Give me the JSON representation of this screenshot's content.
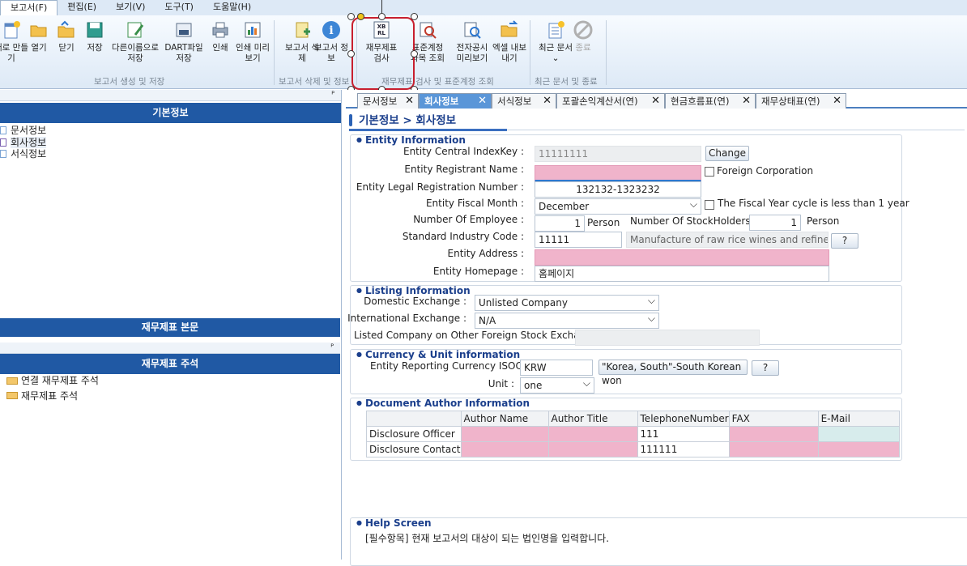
{
  "menu": [
    "보고서(F)",
    "편집(E)",
    "보기(V)",
    "도구(T)",
    "도움말(H)"
  ],
  "ribbon": {
    "buttons": [
      "새로 만들기",
      "열기",
      "닫기",
      "저장",
      "다른이름으로 저장",
      "DART파일 저장",
      "인쇄",
      "인쇄 미리보기",
      "보고서 삭제",
      "보고서 정보",
      "재무제표 검사",
      "표준계정과목 조회",
      "전자공시 미리보기",
      "엑셀 내보내기",
      "최근 문서",
      "종료"
    ],
    "groups": [
      "보고서 생성 및 저장",
      "보고서 삭제 및 정보",
      "재무제표 검사 및 표준계정 조회",
      "최근 문서 및 종료"
    ]
  },
  "left": {
    "pin": "ᴾ",
    "basic_header": "기본정보",
    "basic_items": [
      "문서정보",
      "회사정보",
      "서식정보"
    ],
    "body_header": "재무제표 본문",
    "notes_header": "재무제표 주석",
    "notes_items": [
      "연결 재무제표 주석",
      "재무제표 주석"
    ]
  },
  "tabs": [
    "문서정보",
    "회사정보",
    "서식정보",
    "포괄손익계산서(연)",
    "현금흐름표(연)",
    "재무상태표(연)"
  ],
  "close_glyph": "✕",
  "breadcrumb": "기본정보 > 회사정보",
  "entity": {
    "title": "Entity Information",
    "central_key_label": "Entity Central IndexKey :",
    "central_key_value": "11111111",
    "change_btn": "Change",
    "registrant_label": "Entity Registrant Name :",
    "registrant_value": "",
    "foreign_corp": "Foreign Corporation",
    "legal_reg_label": "Entity Legal Registration Number :",
    "legal_reg_value": "132132-1323232",
    "fiscal_month_label": "Entity Fiscal Month :",
    "fiscal_month_value": "December",
    "fiscal_short": "The Fiscal Year cycle is less than 1 year",
    "employee_label": "Number Of Employee :",
    "employee_value": "1",
    "person": "Person",
    "stockholders_label": "Number Of StockHolders :",
    "stockholders_value": "1",
    "industry_label": "Standard Industry Code :",
    "industry_value": "11111",
    "industry_desc": "Manufacture of raw rice wines and refined rice",
    "help_btn": "?",
    "address_label": "Entity Address :",
    "address_value": "",
    "homepage_label": "Entity Homepage :",
    "homepage_value": "홈페이지"
  },
  "listing": {
    "title": "Listing Information",
    "domestic_label": "Domestic Exchange :",
    "domestic_value": "Unlisted Company",
    "intl_label": "International Exchange :",
    "intl_value": "N/A",
    "other_label": "Listed Company on Other Foreign Stock Exchange :"
  },
  "currency": {
    "title": "Currency & Unit information",
    "iso_label": "Entity Reporting Currency ISOCode",
    "iso_value": "KRW",
    "iso_desc": "\"Korea, South\"-South Korean won",
    "unit_label": "Unit :",
    "unit_value": "one"
  },
  "author": {
    "title": "Document Author Information",
    "columns": [
      "Author Name",
      "Author Title",
      "TelephoneNumber",
      "FAX",
      "E-Mail"
    ],
    "rows": [
      {
        "role": "Disclosure Officer",
        "phone": "111"
      },
      {
        "role": "Disclosure Contact",
        "phone": "111111"
      }
    ]
  },
  "help": {
    "title": "Help Screen",
    "text": "[필수항목] 현재 보고서의 대상이 되는 법인명을 입력합니다."
  }
}
